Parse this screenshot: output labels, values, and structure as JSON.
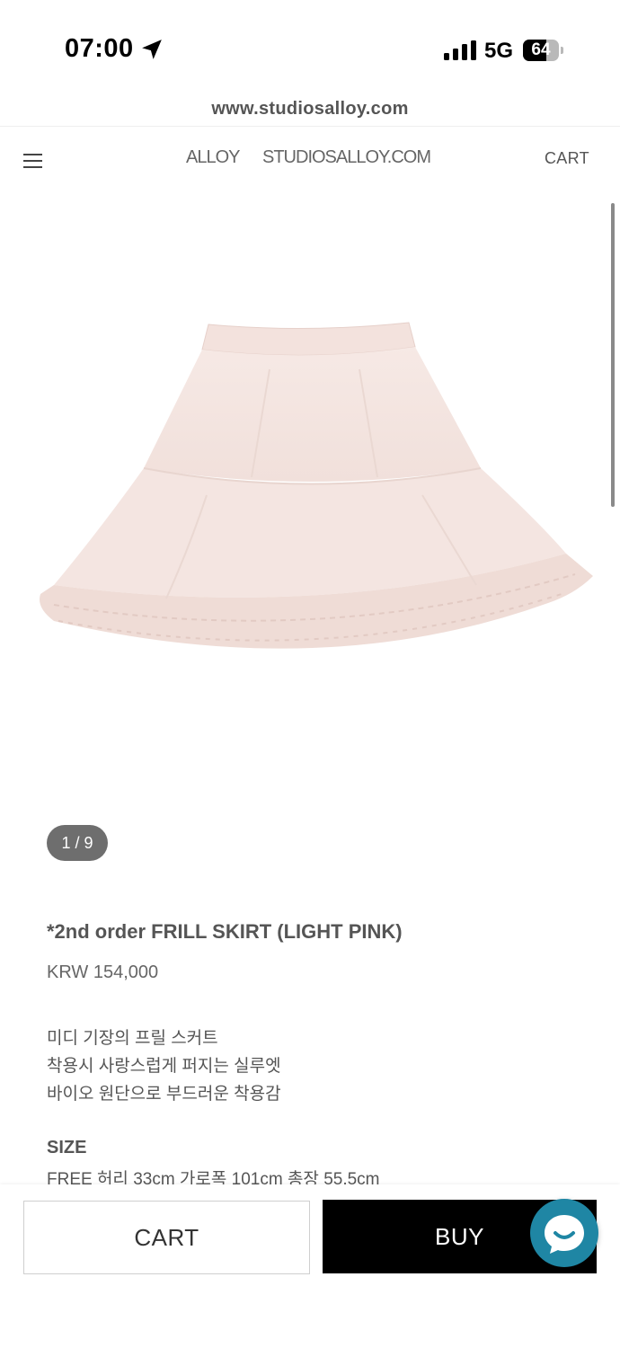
{
  "status": {
    "time": "07:00",
    "network": "5G",
    "battery_level": 64,
    "battery_label": "64"
  },
  "browser": {
    "url": "www.studiosalloy.com"
  },
  "header": {
    "brand_left": "ALLOY",
    "brand_right": "STUDIOSALLOY.COM",
    "cart_label": "CART"
  },
  "gallery": {
    "counter": "1 / 9"
  },
  "product": {
    "title": "*2nd order FRILL SKIRT (LIGHT PINK)",
    "price": "KRW 154,000",
    "description": [
      "미디 기장의 프릴 스커트",
      "착용시 사랑스럽게 퍼지는 실루엣",
      "바이오 원단으로 부드러운 착용감"
    ],
    "size_label": "SIZE",
    "size_value": "FREE 허리 33cm 가로폭 101cm 총장 55.5cm"
  },
  "actions": {
    "cart_label": "CART",
    "buy_label": "BUY"
  },
  "colors": {
    "skirt": "#f4e3de",
    "buy_button": "#000000",
    "chat_button": "#1f86a4",
    "counter_pill": "#6e6e6e"
  },
  "icons": {
    "menu": "hamburger-menu-icon",
    "location": "location-arrow-icon",
    "signal": "cellular-signal-icon",
    "battery": "battery-icon",
    "chat": "chat-bubble-icon"
  }
}
